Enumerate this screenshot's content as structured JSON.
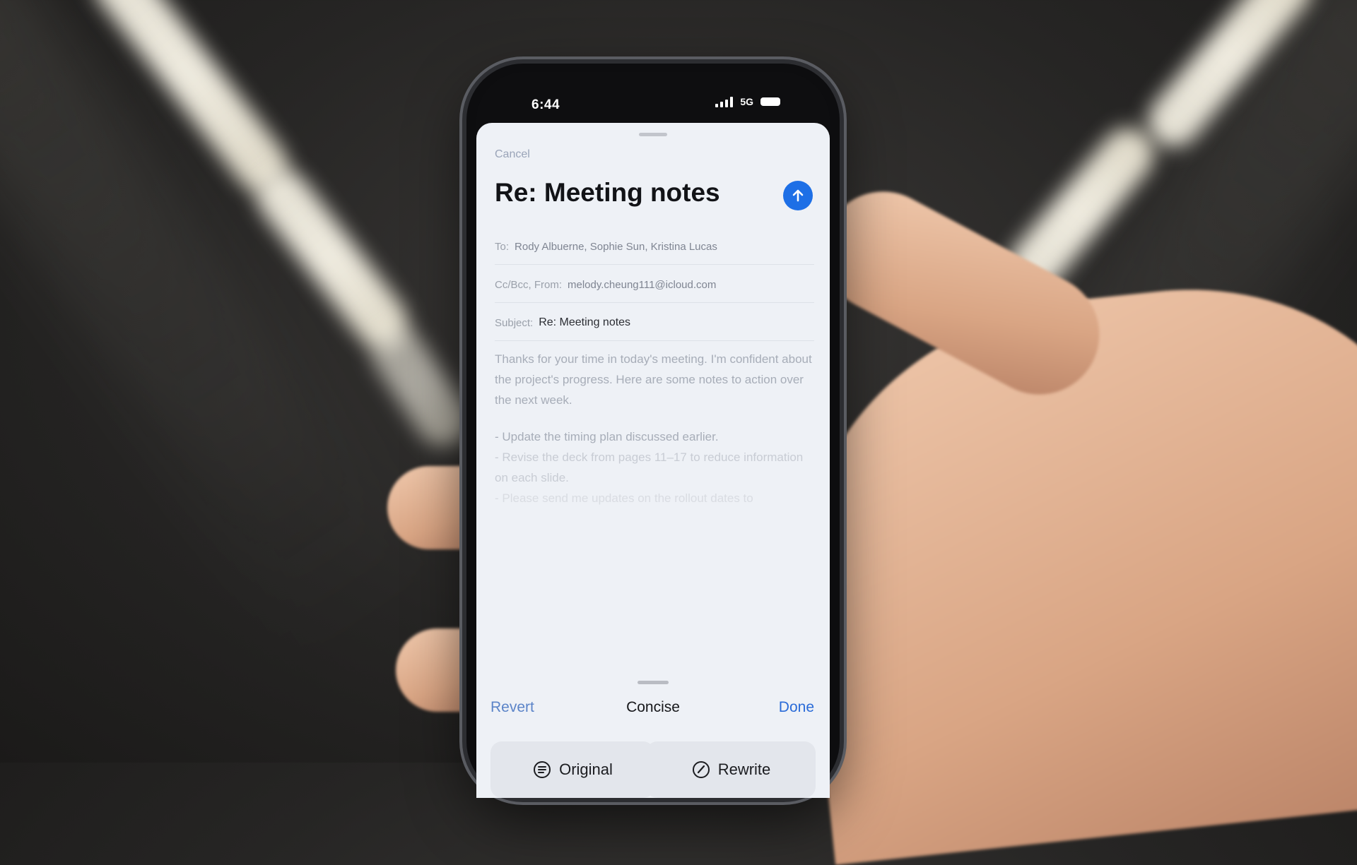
{
  "status_bar": {
    "time": "6:44",
    "network": "5G"
  },
  "compose": {
    "cancel_label": "Cancel",
    "title": "Re: Meeting notes",
    "to_label": "To:",
    "to_value": "Rody Albuerne, Sophie Sun, Kristina Lucas",
    "ccbcc_label": "Cc/Bcc, From:",
    "from_value": "melody.cheung111@icloud.com",
    "subject_label": "Subject:",
    "subject_value": "Re: Meeting notes",
    "body_p1": "Thanks for your time in today's meeting. I'm confident about the project's progress. Here are some notes to action over the next week.",
    "bullet1": "- Update the timing plan discussed earlier.",
    "bullet2": "- Revise the deck from pages 11–17 to reduce information on each slide.",
    "bullet3": "- Please send me updates on the rollout dates to"
  },
  "writing_tools": {
    "revert_label": "Revert",
    "mode_label": "Concise",
    "done_label": "Done",
    "original_label": "Original",
    "rewrite_label": "Rewrite"
  },
  "colors": {
    "send_button": "#1d6fe6",
    "done": "#2a6bd8",
    "revert": "#5b84c8"
  },
  "icons": [
    "send-arrow-icon",
    "signal-icon",
    "battery-icon",
    "original-icon",
    "rewrite-icon"
  ]
}
